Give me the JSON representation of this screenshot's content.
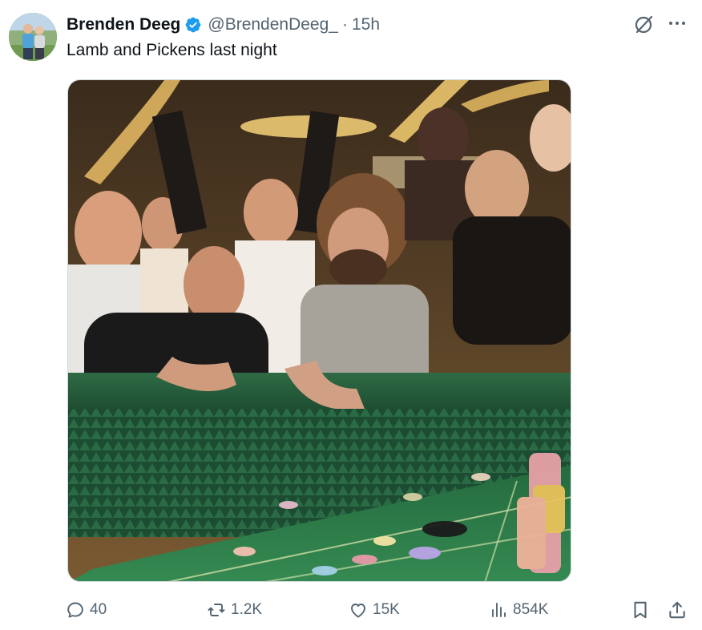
{
  "post": {
    "author_name": "Brenden Deeg",
    "handle": "@BrendenDeeg_",
    "separator": "·",
    "time": "15h",
    "text": "Lamb and Pickens last night",
    "media_description_icon": "casino-craps-photo"
  },
  "stats": {
    "replies": "40",
    "reposts": "1.2K",
    "likes": "15K",
    "views": "854K"
  },
  "colors": {
    "text_primary": "#0f1419",
    "text_secondary": "#536471",
    "verified_blue": "#1d9bf0",
    "table_green": "#2f7a4a"
  }
}
